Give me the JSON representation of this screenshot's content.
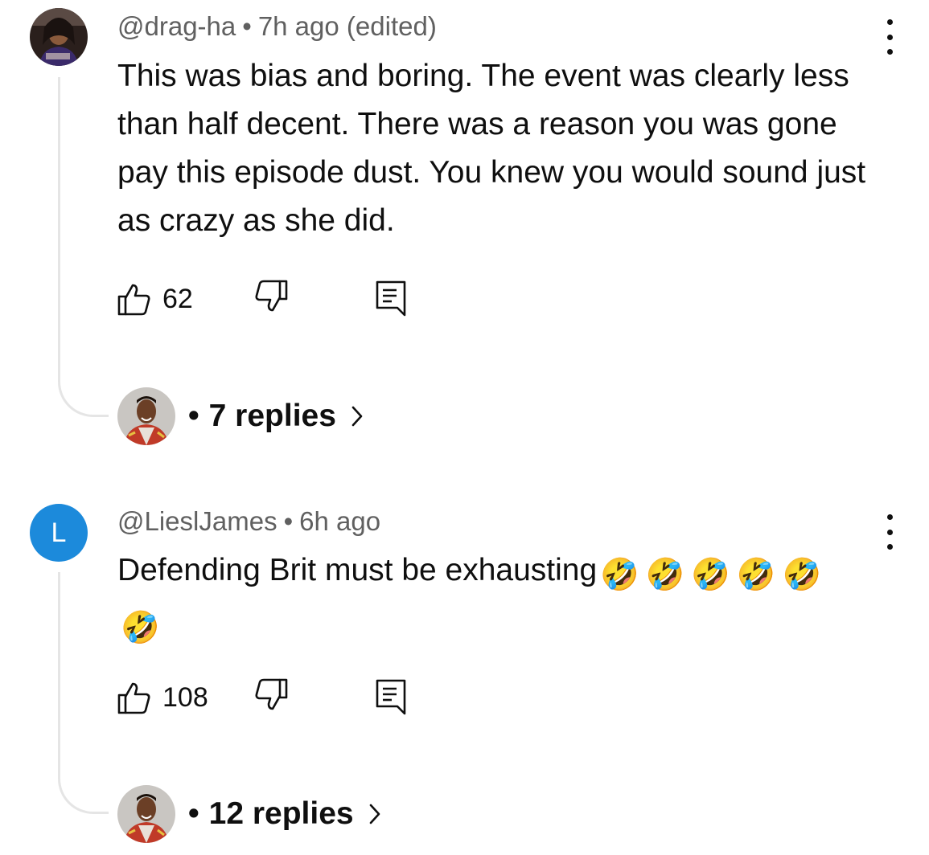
{
  "comments": [
    {
      "handle": "@drag-ha",
      "time": "7h ago (edited)",
      "text": "This was bias and boring. The event was clearly less than half decent. There was a reason you was gone pay this episode dust. You knew you would sound just as crazy as she did.",
      "likes": "62",
      "replies": "7 replies",
      "avatar_icon": "profile-photo"
    },
    {
      "handle": "@LieslJames",
      "time": "6h ago",
      "avatar_letter": "L",
      "avatar_color": "#1c8adb",
      "text_prefix": "Defending Brit must be exhausting",
      "emoji": [
        "🤣",
        "🤣",
        "🤣",
        "🤣",
        "🤣",
        "🤣"
      ],
      "likes": "108",
      "replies": "12 replies"
    }
  ],
  "icons": {
    "like": "thumbs-up-icon",
    "dislike": "thumbs-down-icon",
    "reply": "reply-comment-icon",
    "menu": "more-vertical-icon",
    "chevron": "chevron-right-icon"
  },
  "separator": "•"
}
